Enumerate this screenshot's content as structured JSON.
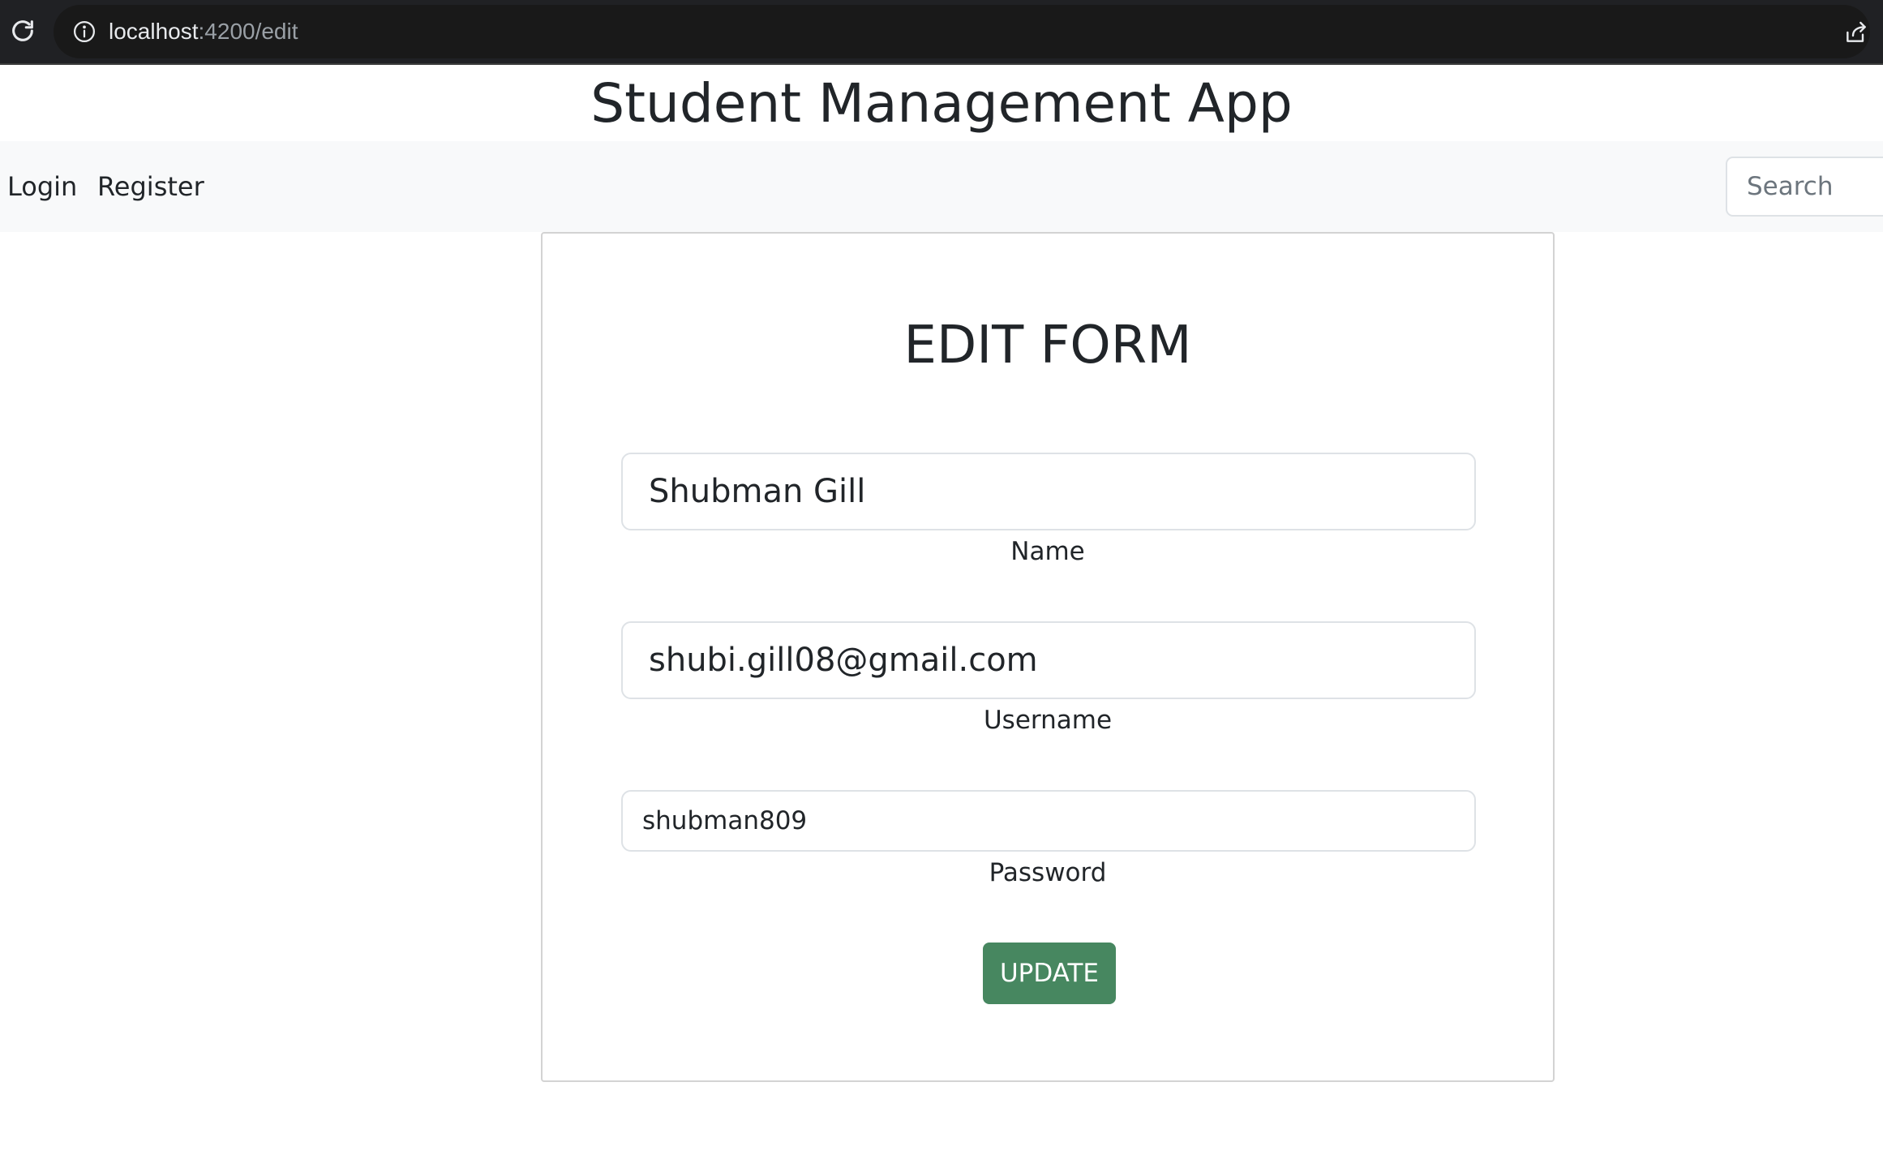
{
  "browser": {
    "url_host": "localhost",
    "url_path": ":4200/edit",
    "icons": {
      "reload": "reload-icon",
      "info": "info-icon",
      "share": "share-icon"
    }
  },
  "app": {
    "title": "Student Management App"
  },
  "nav": {
    "login_label": "Login",
    "register_label": "Register",
    "search_placeholder": "Search"
  },
  "form": {
    "title": "EDIT FORM",
    "name": {
      "value": "Shubman Gill",
      "label": "Name"
    },
    "username": {
      "value": "shubi.gill08@gmail.com",
      "label": "Username"
    },
    "password": {
      "value": "shubman809",
      "label": "Password"
    },
    "submit_label": "UPDATE"
  },
  "colors": {
    "browser_bar": "#202124",
    "navbar_bg": "#f8f9fa",
    "update_button": "#478760",
    "text": "#212529"
  }
}
